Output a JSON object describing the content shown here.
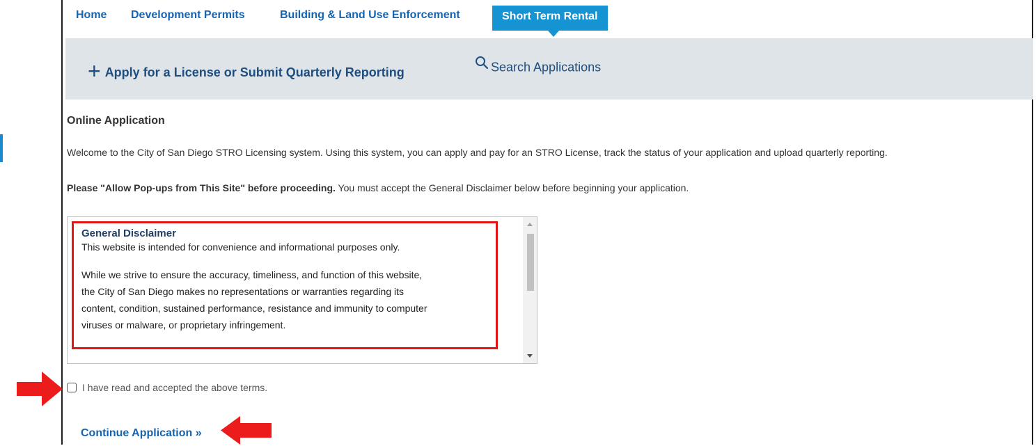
{
  "nav": {
    "tabs": [
      {
        "label": "Home"
      },
      {
        "label": "Development Permits"
      },
      {
        "label": "Building & Land Use Enforcement"
      },
      {
        "label": "Short Term Rental"
      }
    ]
  },
  "action_bar": {
    "apply_label": "Apply for a License or Submit Quarterly Reporting",
    "search_label": "Search Applications"
  },
  "main": {
    "title": "Online Application",
    "welcome": "Welcome to the City of San Diego STRO Licensing system.  Using this system, you can apply and pay for an STRO License, track the status of your application and upload quarterly reporting.",
    "popup_bold": "Please \"Allow Pop-ups from This Site\" before proceeding.",
    "popup_rest": " You must accept the General Disclaimer below before beginning your application."
  },
  "disclaimer": {
    "heading": "General Disclaimer",
    "p1": "This website is intended for convenience and informational purposes only.",
    "lines": [
      "While we strive to ensure the accuracy, timeliness, and function of this website,",
      "the City of San Diego makes no representations or warranties regarding its",
      "content, condition, sustained performance, resistance and immunity to computer",
      "viruses or malware, or proprietary infringement."
    ]
  },
  "terms": {
    "checked": false,
    "label": "I have read and accepted the above terms."
  },
  "continue_label": "Continue Application »",
  "colors": {
    "tab_active": "#1693d2",
    "link": "#1663b0",
    "highlight": "#e01616",
    "arrow": "#ec1c1c"
  },
  "icons": {
    "plus": "plus-icon",
    "search": "search-icon",
    "arrow": "red-arrow-icon"
  }
}
